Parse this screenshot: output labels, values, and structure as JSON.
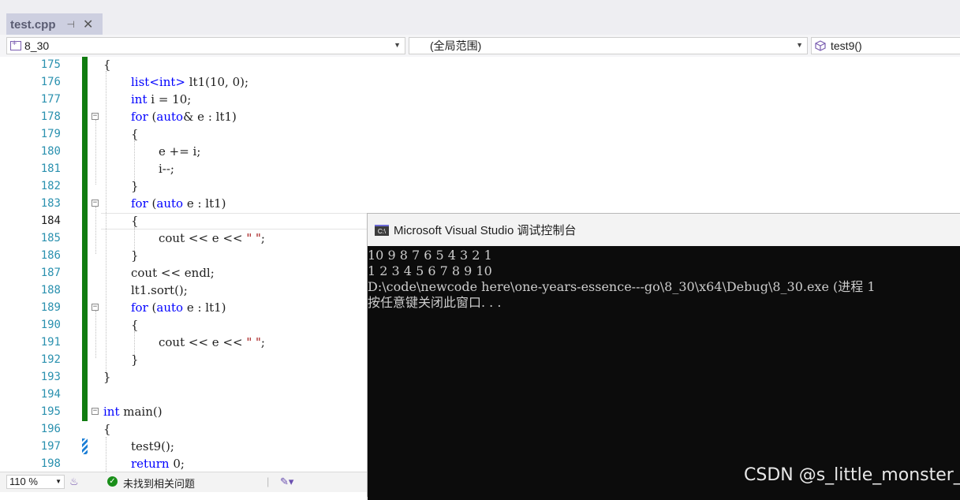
{
  "tabs": [
    {
      "label": "test.cpp",
      "pin": "⊣",
      "close": "✕"
    }
  ],
  "navbar": {
    "project": "8_30",
    "scope": "(全局范围)",
    "member": "test9()"
  },
  "editor": {
    "current_line": "184",
    "lines": [
      {
        "n": "175",
        "indent": 0,
        "tokens": [
          {
            "t": "{"
          }
        ]
      },
      {
        "n": "176",
        "indent": 1,
        "tokens": [
          {
            "t": "list",
            "c": "kw"
          },
          {
            "t": "<",
            "c": "kw"
          },
          {
            "t": "int",
            "c": "kw"
          },
          {
            "t": ">",
            "c": "kw"
          },
          {
            "t": " lt1(10, 0);"
          }
        ]
      },
      {
        "n": "177",
        "indent": 1,
        "tokens": [
          {
            "t": "int",
            "c": "kw"
          },
          {
            "t": " i = 10;"
          }
        ]
      },
      {
        "n": "178",
        "indent": 1,
        "tokens": [
          {
            "t": "for",
            "c": "kw"
          },
          {
            "t": " ("
          },
          {
            "t": "auto",
            "c": "kw"
          },
          {
            "t": "& e : lt1)"
          }
        ]
      },
      {
        "n": "179",
        "indent": 1,
        "tokens": [
          {
            "t": "{"
          }
        ]
      },
      {
        "n": "180",
        "indent": 2,
        "tokens": [
          {
            "t": "e += i;"
          }
        ]
      },
      {
        "n": "181",
        "indent": 2,
        "tokens": [
          {
            "t": "i--;"
          }
        ]
      },
      {
        "n": "182",
        "indent": 1,
        "tokens": [
          {
            "t": "}"
          }
        ]
      },
      {
        "n": "183",
        "indent": 1,
        "tokens": [
          {
            "t": "for",
            "c": "kw"
          },
          {
            "t": " ("
          },
          {
            "t": "auto",
            "c": "kw"
          },
          {
            "t": " e : lt1)"
          }
        ]
      },
      {
        "n": "184",
        "indent": 1,
        "tokens": [
          {
            "t": "{"
          }
        ]
      },
      {
        "n": "185",
        "indent": 2,
        "tokens": [
          {
            "t": "cout << e << "
          },
          {
            "t": "\" \"",
            "c": "str"
          },
          {
            "t": ";"
          }
        ]
      },
      {
        "n": "186",
        "indent": 1,
        "tokens": [
          {
            "t": "}"
          }
        ]
      },
      {
        "n": "187",
        "indent": 1,
        "tokens": [
          {
            "t": "cout << endl;"
          }
        ]
      },
      {
        "n": "188",
        "indent": 1,
        "tokens": [
          {
            "t": "lt1.sort();"
          }
        ]
      },
      {
        "n": "189",
        "indent": 1,
        "tokens": [
          {
            "t": "for",
            "c": "kw"
          },
          {
            "t": " ("
          },
          {
            "t": "auto",
            "c": "kw"
          },
          {
            "t": " e : lt1)"
          }
        ]
      },
      {
        "n": "190",
        "indent": 1,
        "tokens": [
          {
            "t": "{"
          }
        ]
      },
      {
        "n": "191",
        "indent": 2,
        "tokens": [
          {
            "t": "cout << e << "
          },
          {
            "t": "\" \"",
            "c": "str"
          },
          {
            "t": ";"
          }
        ]
      },
      {
        "n": "192",
        "indent": 1,
        "tokens": [
          {
            "t": "}"
          }
        ]
      },
      {
        "n": "193",
        "indent": 0,
        "tokens": [
          {
            "t": "}"
          }
        ]
      },
      {
        "n": "194",
        "indent": 0,
        "tokens": []
      },
      {
        "n": "195",
        "indent": 0,
        "tokens": [
          {
            "t": "int",
            "c": "kw"
          },
          {
            "t": " main()"
          }
        ]
      },
      {
        "n": "196",
        "indent": 0,
        "tokens": [
          {
            "t": "{"
          }
        ]
      },
      {
        "n": "197",
        "indent": 1,
        "tokens": [
          {
            "t": "test9();"
          }
        ]
      },
      {
        "n": "198",
        "indent": 1,
        "tokens": [
          {
            "t": "return",
            "c": "kw"
          },
          {
            "t": " 0;"
          }
        ]
      }
    ]
  },
  "statusbar": {
    "zoom": "110 %",
    "issues": "未找到相关问题"
  },
  "console": {
    "title": "Microsoft Visual Studio 调试控制台",
    "icon_text": "C:\\",
    "output": [
      "10 9 8 7 6 5 4 3 2 1",
      "1 2 3 4 5 6 7 8 9 10",
      "D:\\code\\newcode here\\one-years-essence---go\\8_30\\x64\\Debug\\8_30.exe (进程 1",
      "按任意键关闭此窗口. . ."
    ]
  },
  "watermark": "CSDN @s_little_monster_",
  "colors": {
    "keyword": "#0000ff",
    "string": "#a31515",
    "line_number": "#2b91af",
    "change_bar": "#107c10"
  }
}
